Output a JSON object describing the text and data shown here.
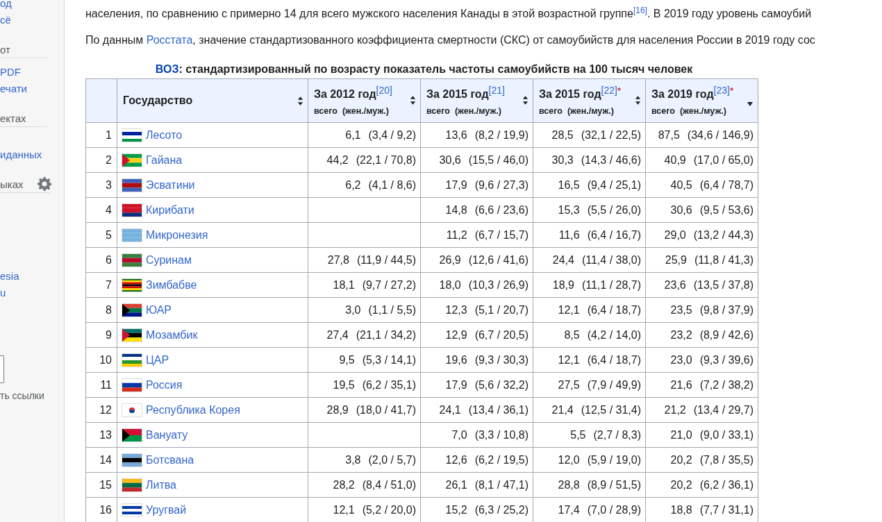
{
  "sidebar": {
    "sections": [
      {
        "items": [
          "од",
          "сё"
        ]
      },
      {
        "heading": "от",
        "gear": false,
        "items": [
          "PDF",
          "ечати"
        ]
      },
      {
        "heading": "ектах",
        "gear": false,
        "items": [
          "иданных"
        ]
      },
      {
        "heading": "ыках",
        "gear": true,
        "items": [
          "esia",
          "u"
        ]
      }
    ],
    "footer": "ть ссылки"
  },
  "paragraphs": [
    {
      "before": "населения, по сравнению с примерно 14 для всего мужского населения Канады в этой возрастной группе",
      "ref": "[16]",
      "after": ". В 2019 году уровень самоубий"
    },
    {
      "before": "По данным ",
      "link": "Росстата",
      "after": ", значение стандартизованного коэффициента смертности (СКС) от самоубийств для населения России в 2019 году сос"
    }
  ],
  "table": {
    "caption": {
      "link": "ВОЗ",
      "text": ": стандартизированный по возрасту показатель частоты самоубийств на 100 тысяч человек"
    },
    "columns": [
      {
        "kind": "rank"
      },
      {
        "kind": "country",
        "title": "Государство",
        "sorted": false
      },
      {
        "kind": "value",
        "title": "За 2012 год",
        "ref": "[20]",
        "subtitle": "всего  (жен./муж.)",
        "sorted": false
      },
      {
        "kind": "value",
        "title": "За 2015 год",
        "ref": "[21]",
        "subtitle": "всего  (жен./муж.)",
        "sorted": false
      },
      {
        "kind": "value",
        "title": "За 2015 год",
        "ref": "[22]",
        "note": "*",
        "subtitle": "всего  (жен./муж.)",
        "sorted": false
      },
      {
        "kind": "value",
        "title": "За 2019 год",
        "ref": "[23]",
        "note": "*",
        "subtitle": "всего  (жен./муж.)",
        "sorted": true
      }
    ],
    "rows": [
      {
        "rank": "1",
        "country": "Лесото",
        "values": [
          {
            "kind": "value",
            "total": "6,1",
            "split": "(3,4 / 9,2)"
          },
          {
            "kind": "value",
            "total": "13,6",
            "split": "(8,2 / 19,9)"
          },
          {
            "kind": "value",
            "total": "28,5",
            "split": "(32,1 / 22,5)"
          },
          {
            "kind": "value",
            "total": "87,5",
            "split": "(34,6 / 146,9)"
          }
        ]
      },
      {
        "rank": "2",
        "country": "Гайана",
        "values": [
          {
            "kind": "value",
            "total": "44,2",
            "split": "(22,1 / 70,8)"
          },
          {
            "kind": "value",
            "total": "30,6",
            "split": "(15,5 / 46,0)"
          },
          {
            "kind": "value",
            "total": "30,3",
            "split": "(14,3 / 46,6)"
          },
          {
            "kind": "value",
            "total": "40,9",
            "split": "(17,0 / 65,0)"
          }
        ]
      },
      {
        "rank": "3",
        "country": "Эсватини",
        "values": [
          {
            "kind": "value",
            "total": "6,2",
            "split": "(4,1 / 8,6)"
          },
          {
            "kind": "value",
            "total": "17,9",
            "split": "(9,6 / 27,3)"
          },
          {
            "kind": "value",
            "total": "16,5",
            "split": "(9,4 / 25,1)"
          },
          {
            "kind": "value",
            "total": "40,5",
            "split": "(6,4 / 78,7)"
          }
        ]
      },
      {
        "rank": "4",
        "country": "Кирибати",
        "values": [
          {
            "kind": "blank"
          },
          {
            "kind": "value",
            "total": "14,8",
            "split": "(6,6 / 23,6)"
          },
          {
            "kind": "value",
            "total": "15,3",
            "split": "(5,5 / 26,0)"
          },
          {
            "kind": "value",
            "total": "30,6",
            "split": "(9,5 / 53,6)"
          }
        ]
      },
      {
        "rank": "5",
        "country": "Микронезия",
        "values": [
          {
            "kind": "blank"
          },
          {
            "kind": "value",
            "total": "11,2",
            "split": "(6,7 / 15,7)"
          },
          {
            "kind": "value",
            "total": "11,6",
            "split": "(6,4 / 16,7)"
          },
          {
            "kind": "value",
            "total": "29,0",
            "split": "(13,2 / 44,3)"
          }
        ]
      },
      {
        "rank": "6",
        "country": "Суринам",
        "values": [
          {
            "kind": "value",
            "total": "27,8",
            "split": "(11,9 / 44,5)"
          },
          {
            "kind": "value",
            "total": "26,9",
            "split": "(12,6 / 41,6)"
          },
          {
            "kind": "value",
            "total": "24,4",
            "split": "(11,4 / 38,0)"
          },
          {
            "kind": "value",
            "total": "25,9",
            "split": "(11,8 / 41,3)"
          }
        ]
      },
      {
        "rank": "7",
        "country": "Зимбабве",
        "values": [
          {
            "kind": "value",
            "total": "18,1",
            "split": "(9,7 / 27,2)"
          },
          {
            "kind": "value",
            "total": "18,0",
            "split": "(10,3 / 26,9)"
          },
          {
            "kind": "value",
            "total": "18,9",
            "split": "(11,1 / 28,7)"
          },
          {
            "kind": "value",
            "total": "23,6",
            "split": "(13,5 / 37,8)"
          }
        ]
      },
      {
        "rank": "8",
        "country": "ЮАР",
        "values": [
          {
            "kind": "value",
            "total": "3,0",
            "split": "(1,1 / 5,5)"
          },
          {
            "kind": "value",
            "total": "12,3",
            "split": "(5,1 / 20,7)"
          },
          {
            "kind": "value",
            "total": "12,1",
            "split": "(6,4 / 18,7)"
          },
          {
            "kind": "value",
            "total": "23,5",
            "split": "(9,8 / 37,9)"
          }
        ]
      },
      {
        "rank": "9",
        "country": "Мозамбик",
        "values": [
          {
            "kind": "value",
            "total": "27,4",
            "split": "(21,1 / 34,2)"
          },
          {
            "kind": "value",
            "total": "12,9",
            "split": "(6,7 / 20,5)"
          },
          {
            "kind": "value",
            "total": "8,5",
            "split": "(4,2 / 14,0)"
          },
          {
            "kind": "value",
            "total": "23,2",
            "split": "(8,9 / 42,6)"
          }
        ]
      },
      {
        "rank": "10",
        "country": "ЦАР",
        "values": [
          {
            "kind": "value",
            "total": "9,5",
            "split": "(5,3 / 14,1)"
          },
          {
            "kind": "value",
            "total": "19,6",
            "split": "(9,3 / 30,3)"
          },
          {
            "kind": "value",
            "total": "12,1",
            "split": "(6,4 / 18,7)"
          },
          {
            "kind": "value",
            "total": "23,0",
            "split": "(9,3 / 39,6)"
          }
        ]
      },
      {
        "rank": "11",
        "country": "Россия",
        "values": [
          {
            "kind": "value",
            "total": "19,5",
            "split": "(6,2 / 35,1)"
          },
          {
            "kind": "value",
            "total": "17,9",
            "split": "(5,6 / 32,2)"
          },
          {
            "kind": "value",
            "total": "27,5",
            "split": "(7,9 / 49,9)"
          },
          {
            "kind": "value",
            "total": "21,6",
            "split": "(7,2 / 38,2)"
          }
        ]
      },
      {
        "rank": "12",
        "country": "Республика Корея",
        "values": [
          {
            "kind": "value",
            "total": "28,9",
            "split": "(18,0 / 41,7)"
          },
          {
            "kind": "value",
            "total": "24,1",
            "split": "(13,4 / 36,1)"
          },
          {
            "kind": "value",
            "total": "21,4",
            "split": "(12,5 / 31,4)"
          },
          {
            "kind": "value",
            "total": "21,2",
            "split": "(13,4 / 29,7)"
          }
        ]
      },
      {
        "rank": "13",
        "country": "Вануату",
        "values": [
          {
            "kind": "blank"
          },
          {
            "kind": "value",
            "total": "7,0",
            "split": "(3,3 / 10,8)"
          },
          {
            "kind": "value",
            "total": "5,5",
            "split": "(2,7 / 8,3)"
          },
          {
            "kind": "value",
            "total": "21,0",
            "split": "(9,0 / 33,1)"
          }
        ]
      },
      {
        "rank": "14",
        "country": "Ботсвана",
        "values": [
          {
            "kind": "value",
            "total": "3,8",
            "split": "(2,0 / 5,7)"
          },
          {
            "kind": "value",
            "total": "12,6",
            "split": "(6,2 / 19,5)"
          },
          {
            "kind": "value",
            "total": "12,0",
            "split": "(5,9 / 19,0)"
          },
          {
            "kind": "value",
            "total": "20,2",
            "split": "(7,8 / 35,5)"
          }
        ]
      },
      {
        "rank": "15",
        "country": "Литва",
        "values": [
          {
            "kind": "value",
            "total": "28,2",
            "split": "(8,4 / 51,0)"
          },
          {
            "kind": "value",
            "total": "26,1",
            "split": "(8,1 / 47,1)"
          },
          {
            "kind": "value",
            "total": "28,8",
            "split": "(8,9 / 51,5)"
          },
          {
            "kind": "value",
            "total": "20,2",
            "split": "(6,2 / 36,1)"
          }
        ]
      },
      {
        "rank": "16",
        "country": "Уругвай",
        "values": [
          {
            "kind": "value",
            "total": "12,1",
            "split": "(5,2 / 20,0)"
          },
          {
            "kind": "value",
            "total": "15,2",
            "split": "(6,3 / 25,2)"
          },
          {
            "kind": "value",
            "total": "17,4",
            "split": "(7,0 / 28,9)"
          },
          {
            "kind": "value",
            "total": "18,8",
            "split": "(7,7 / 31,1)"
          }
        ]
      }
    ]
  }
}
